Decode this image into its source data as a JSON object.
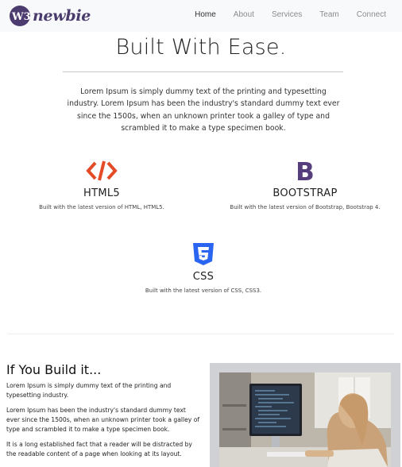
{
  "brand": {
    "logo_text": "W3",
    "name": "newbie"
  },
  "nav": {
    "items": [
      {
        "label": "Home",
        "active": true
      },
      {
        "label": "About",
        "active": false
      },
      {
        "label": "Services",
        "active": false
      },
      {
        "label": "Team",
        "active": false
      },
      {
        "label": "Connect",
        "active": false
      }
    ]
  },
  "hero": {
    "title": "Built With Ease.",
    "text": "Lorem Ipsum is simply dummy text of the printing and typesetting industry. Lorem Ipsum has been the industry's standard dummy text ever since the 1500s, when an unknown printer took a galley of type and scrambled it to make a type specimen book."
  },
  "features": [
    {
      "icon": "html5-code-icon",
      "title": "HTML5",
      "desc": "Built with the latest version of HTML, HTML5.",
      "color": "#e34c26"
    },
    {
      "icon": "bootstrap-icon",
      "title": "BOOTSTRAP",
      "desc": "Built with the latest version of Bootstrap, Bootstrap 4.",
      "color": "#563d7c"
    },
    {
      "icon": "css3-icon",
      "title": "CSS",
      "desc": "Built with the latest version of CSS, CSS3.",
      "color": "#2965f1"
    }
  ],
  "build": {
    "title": "If You Build it...",
    "p1": "Lorem Ipsum is simply dummy text of the printing and typesetting industry.",
    "p2": "Lorem Ipsum has been the industry's standard dummy text ever since the 1500s, when an unknown printer took a galley of type and scrambled it to make a type specimen book.",
    "p3": "It is a long established fact that a reader will be distracted by the readable content of a page when looking at its layout."
  }
}
